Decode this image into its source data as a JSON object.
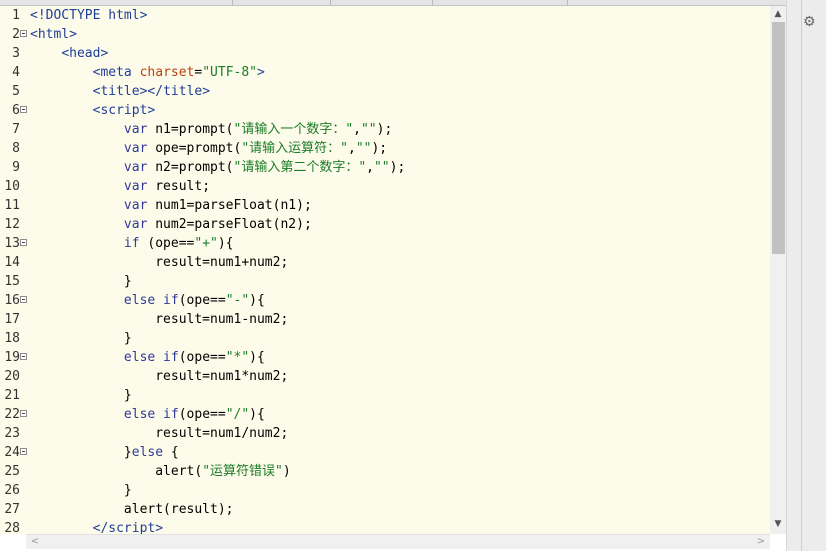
{
  "tab_strip": {
    "tabs": 5
  },
  "editor": {
    "lines": [
      {
        "n": "1",
        "fold": false,
        "html": "<span class=\"tag\">&lt;!DOCTYPE html&gt;</span>"
      },
      {
        "n": "2",
        "fold": true,
        "html": "<span class=\"tag\">&lt;html&gt;</span>"
      },
      {
        "n": "3",
        "fold": false,
        "html": "    <span class=\"tag\">&lt;head&gt;</span>"
      },
      {
        "n": "4",
        "fold": false,
        "html": "        <span class=\"tag\">&lt;meta</span> <span class=\"attr\">charset</span>=<span class=\"str\">\"UTF-8\"</span><span class=\"tag\">&gt;</span>"
      },
      {
        "n": "5",
        "fold": false,
        "html": "        <span class=\"tag\">&lt;title&gt;&lt;/title&gt;</span>"
      },
      {
        "n": "6",
        "fold": true,
        "html": "        <span class=\"tag\">&lt;script&gt;</span>"
      },
      {
        "n": "7",
        "fold": false,
        "html": "            <span class=\"kw\">var</span> n1=prompt(<span class=\"str\">\"请输入一个数字：\"</span>,<span class=\"str\">\"\"</span>);"
      },
      {
        "n": "8",
        "fold": false,
        "html": "            <span class=\"kw\">var</span> ope=prompt(<span class=\"str\">\"请输入运算符：\"</span>,<span class=\"str\">\"\"</span>);"
      },
      {
        "n": "9",
        "fold": false,
        "html": "            <span class=\"kw\">var</span> n2=prompt(<span class=\"str\">\"请输入第二个数字：\"</span>,<span class=\"str\">\"\"</span>);"
      },
      {
        "n": "10",
        "fold": false,
        "html": "            <span class=\"kw\">var</span> result;"
      },
      {
        "n": "11",
        "fold": false,
        "html": "            <span class=\"kw\">var</span> num1=parseFloat(n1);"
      },
      {
        "n": "12",
        "fold": false,
        "html": "            <span class=\"kw\">var</span> num2=parseFloat(n2);"
      },
      {
        "n": "13",
        "fold": true,
        "html": "            <span class=\"kw\">if</span> (ope==<span class=\"str\">\"+\"</span>){"
      },
      {
        "n": "14",
        "fold": false,
        "html": "                result=num1+num2;"
      },
      {
        "n": "15",
        "fold": false,
        "html": "            }"
      },
      {
        "n": "16",
        "fold": true,
        "html": "            <span class=\"kw\">else if</span>(ope==<span class=\"str\">\"-\"</span>){"
      },
      {
        "n": "17",
        "fold": false,
        "html": "                result=num1-num2;"
      },
      {
        "n": "18",
        "fold": false,
        "html": "            }"
      },
      {
        "n": "19",
        "fold": true,
        "html": "            <span class=\"kw\">else if</span>(ope==<span class=\"str\">\"*\"</span>){"
      },
      {
        "n": "20",
        "fold": false,
        "html": "                result=num1*num2;"
      },
      {
        "n": "21",
        "fold": false,
        "html": "            }"
      },
      {
        "n": "22",
        "fold": true,
        "html": "            <span class=\"kw\">else if</span>(ope==<span class=\"str\">\"/\"</span>){"
      },
      {
        "n": "23",
        "fold": false,
        "html": "                result=num1/num2;"
      },
      {
        "n": "24",
        "fold": true,
        "html": "            }<span class=\"kw\">else</span> {"
      },
      {
        "n": "25",
        "fold": false,
        "html": "                alert(<span class=\"str\">\"运算符错误\"</span>)"
      },
      {
        "n": "26",
        "fold": false,
        "html": "            }"
      },
      {
        "n": "27",
        "fold": false,
        "html": "            alert(result);"
      },
      {
        "n": "28",
        "fold": false,
        "html": "        <span class=\"tag\">&lt;/script&gt;</span>"
      }
    ]
  },
  "scrollbars": {
    "vertical_up": "▲",
    "vertical_down": "▼",
    "horizontal_left": "<",
    "horizontal_right": ">",
    "vertical_position": 0.0
  },
  "icons": {
    "settings": "gear-icon"
  },
  "colors": {
    "editor_bg": "#fdfbe9",
    "tag": "#1f3f99",
    "attribute": "#b8420e",
    "string": "#1b7d28",
    "keyword": "#2f3a99"
  }
}
